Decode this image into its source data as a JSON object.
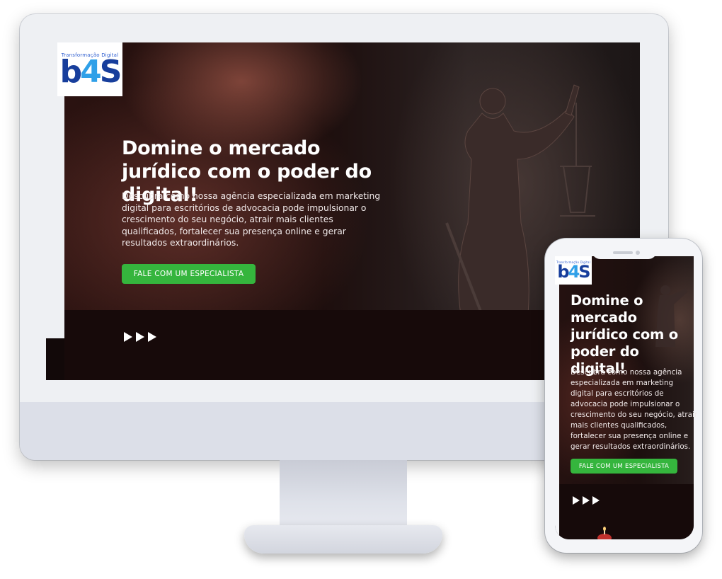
{
  "brand": {
    "tagline": "Transformação Digital",
    "logo_letters": "b",
    "logo_digit": "4",
    "logo_s": "S",
    "primary_color": "#173e9c",
    "accent_color": "#2fa0e8"
  },
  "hero": {
    "title": "Domine o mercado jurídico com o poder do digital!",
    "description": "Descubra como nossa agência especializada em marketing digital para escritórios de advocacia pode impulsionar o crescimento do seu negócio, atrair mais clientes qualificados, fortalecer sua presença online e gerar resultados extraordinários.",
    "cta_label": "FALE COM UM ESPECIALISTA",
    "cta_color": "#35b53d"
  },
  "icons": {
    "scroll_arrows": [
      "play-arrow-icon",
      "play-arrow-icon",
      "play-arrow-icon"
    ],
    "statue": "lady-justice-icon"
  }
}
